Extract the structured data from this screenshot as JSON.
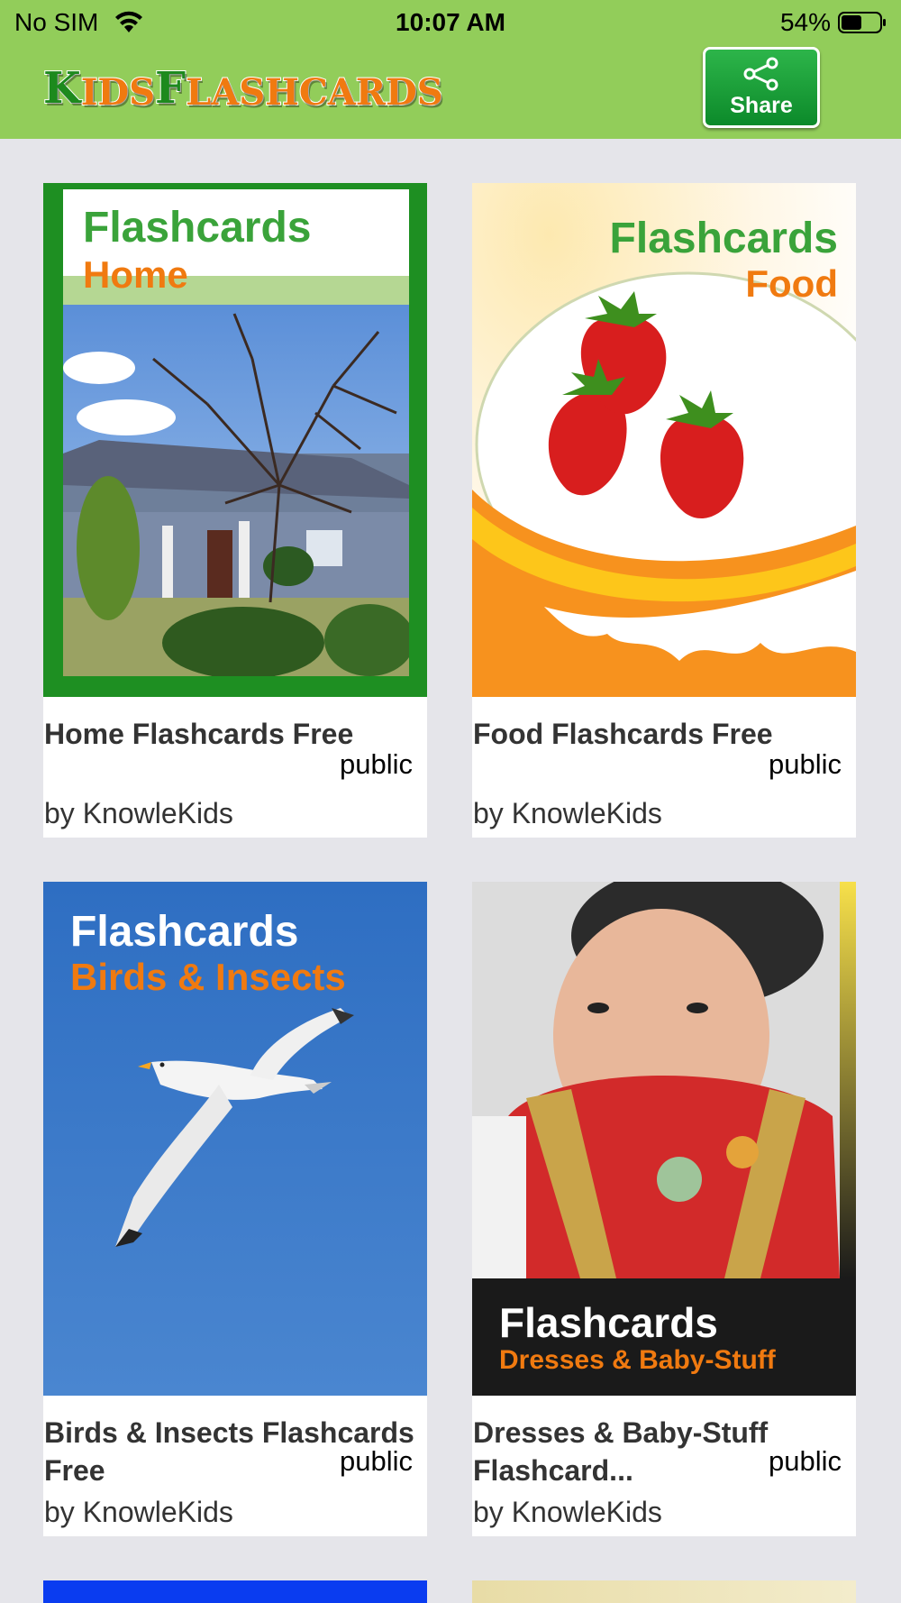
{
  "status_bar": {
    "carrier": "No SIM",
    "time": "10:07 AM",
    "battery": "54%"
  },
  "header": {
    "logo_text": [
      "K",
      "IDS",
      "F",
      "LASHCARDS"
    ],
    "share_label": "Share",
    "background": "#92cd5a"
  },
  "cards": [
    {
      "cover_title": "Flashcards",
      "cover_subtitle": "Home",
      "title": "Home Flashcards Free",
      "visibility": "public",
      "author": "by KnowleKids"
    },
    {
      "cover_title": "Flashcards",
      "cover_subtitle": "Food",
      "title": "Food Flashcards Free",
      "visibility": "public",
      "author": "by KnowleKids"
    },
    {
      "cover_title": "Flashcards",
      "cover_subtitle": "Birds & Insects",
      "title": "Birds & Insects Flashcards Free",
      "visibility": "public",
      "author": "by KnowleKids"
    },
    {
      "cover_title": "Flashcards",
      "cover_subtitle": "Dresses & Baby-Stuff",
      "title": "Dresses & Baby-Stuff Flashcard...",
      "visibility": "public",
      "author": "by KnowleKids"
    }
  ],
  "colors": {
    "accent_green": "#1d8a1d",
    "accent_orange": "#f07a10",
    "page_bg": "#e5e5ea"
  }
}
